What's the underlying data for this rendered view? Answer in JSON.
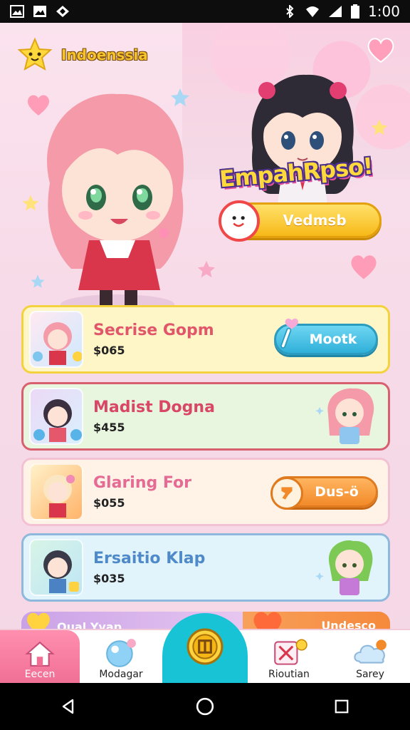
{
  "status_bar": {
    "time": "1:00",
    "left_icons": [
      "gallery-icon",
      "image-icon",
      "sync-icon"
    ],
    "right_icons": [
      "bluetooth-icon",
      "wifi-icon",
      "signal-icon",
      "battery-icon"
    ]
  },
  "header": {
    "brand": "Indoenssia",
    "promo_title": "EmpahRpso!",
    "cta_label": "Vedmsb"
  },
  "cards": [
    {
      "name": "Secrise Gopm",
      "price": "$065",
      "action": "Mootk",
      "name_color": "#e2566a",
      "bg": "#fff6c8",
      "border": "#f3d23e",
      "action_color": "#3dbde0",
      "type": "button"
    },
    {
      "name": "Madist Dogna",
      "price": "$455",
      "action": "",
      "name_color": "#d94766",
      "bg": "#e9f6df",
      "border": "#d8606e",
      "type": "chibi"
    },
    {
      "name": "Glaring For",
      "price": "$055",
      "action": "Dus-ö",
      "name_color": "#e56b94",
      "bg": "#fff3e8",
      "border": "#f2c1d3",
      "action_color": "#f39435",
      "type": "button"
    },
    {
      "name": "Ersaitio Klap",
      "price": "$035",
      "action": "",
      "name_color": "#4e8ac9",
      "bg": "#e2f4fb",
      "border": "#8fb8dd",
      "type": "chibi"
    }
  ],
  "peek_card": {
    "left": "Qual Yvap",
    "right": "Undesco"
  },
  "tabs": [
    {
      "label": "Eecen",
      "icon": "home-icon"
    },
    {
      "label": "Modagar",
      "icon": "bubble-icon"
    },
    {
      "label": "",
      "icon": "coin-icon"
    },
    {
      "label": "Rioutian",
      "icon": "tools-icon"
    },
    {
      "label": "Sarey",
      "icon": "cloud-icon"
    }
  ]
}
